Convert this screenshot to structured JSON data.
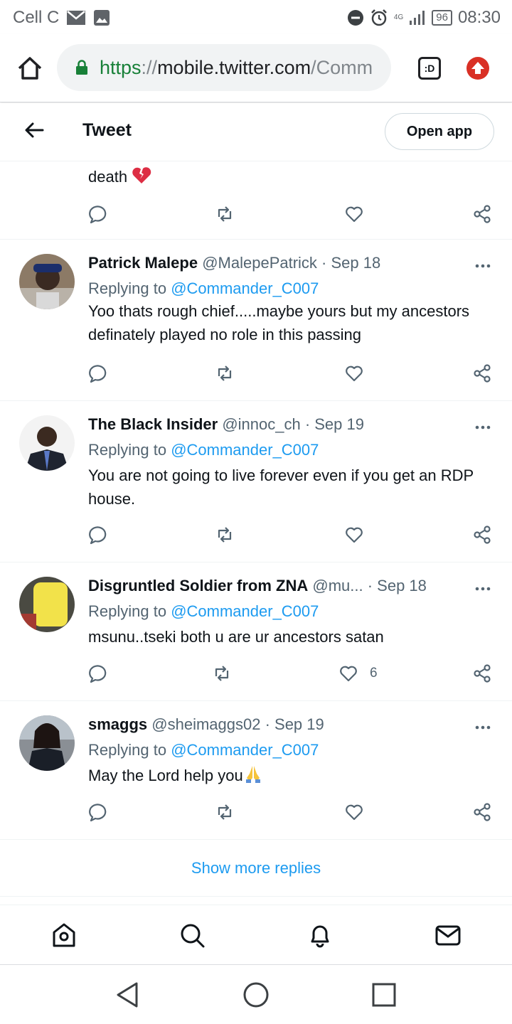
{
  "status_bar": {
    "carrier": "Cell C",
    "network": "4G",
    "battery": "96",
    "time": "08:30"
  },
  "browser": {
    "url_scheme": "https",
    "url_sep": "://",
    "url_host": "mobile.twitter.com",
    "url_path": "/Comm",
    "tab_label": ":D"
  },
  "header": {
    "title": "Tweet",
    "open_app_label": "Open app"
  },
  "partial_tweet": {
    "text": "death"
  },
  "tweets": [
    {
      "name": "Patrick Malepe",
      "meta": "@MalepePatrick · Sep 18",
      "replying_prefix": "Replying to ",
      "mention": "@Commander_C007",
      "text": "Yoo thats rough chief.....maybe yours but my ancestors definately played no role in this passing",
      "likes": ""
    },
    {
      "name": "The Black Insider",
      "meta": "@innoc_ch · Sep 19",
      "replying_prefix": "Replying to ",
      "mention": "@Commander_C007",
      "text": "You are not going to live forever even if you get an RDP house.",
      "likes": ""
    },
    {
      "name": "Disgruntled Soldier from ZNA",
      "meta": "@mu...  · Sep 18",
      "replying_prefix": "Replying to ",
      "mention": "@Commander_C007",
      "text": "msunu..tseki both u are ur ancestors satan",
      "likes": "6"
    },
    {
      "name": "smaggs",
      "meta": "@sheimaggs02 · Sep 19",
      "replying_prefix": "Replying to ",
      "mention": "@Commander_C007",
      "text": "May the Lord help you",
      "likes": ""
    }
  ],
  "show_more_label": "Show more replies",
  "colors": {
    "accent": "#1d9bf0",
    "text_primary": "#0f1419",
    "text_secondary": "#536471",
    "secure_green": "#188038",
    "update_red": "#d93025"
  },
  "icons": {
    "home": "home-icon",
    "search": "search-icon",
    "notifications": "bell-icon",
    "messages": "mail-icon",
    "reply": "reply-icon",
    "retweet": "retweet-icon",
    "like": "heart-icon",
    "share": "share-icon"
  }
}
